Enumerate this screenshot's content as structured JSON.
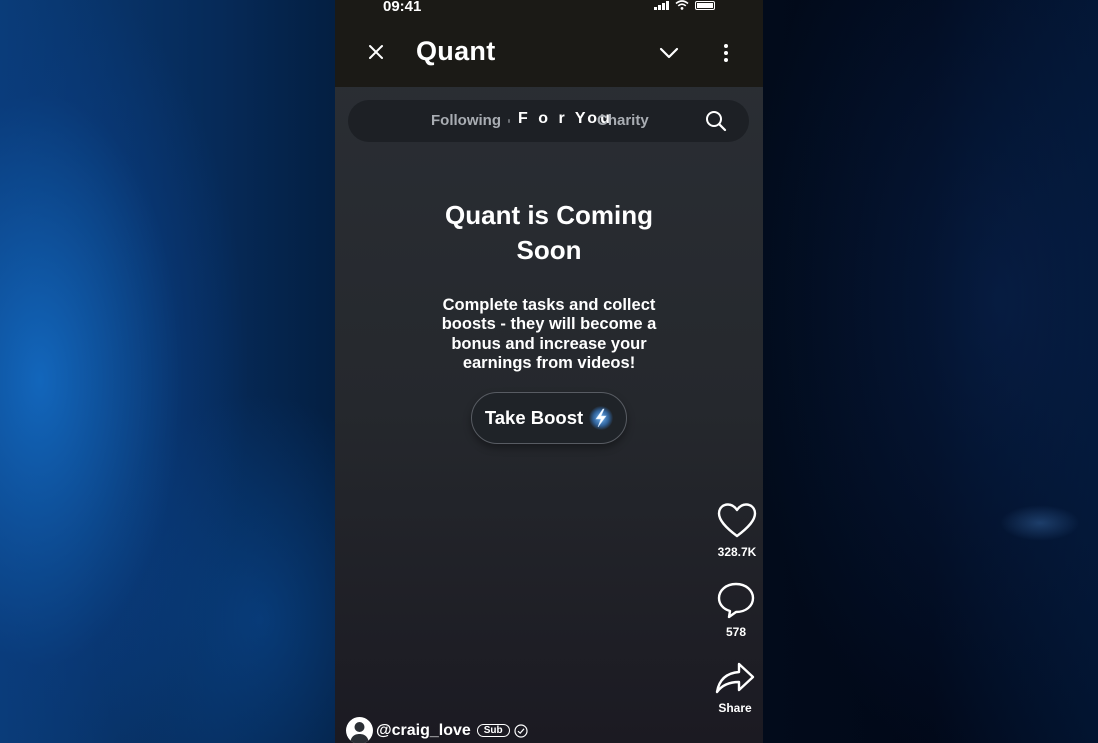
{
  "status_bar": {
    "time": "09:41",
    "icons": [
      "cellular-signal-icon",
      "wifi-icon",
      "battery-icon"
    ]
  },
  "header": {
    "title": "Quant",
    "icons": [
      "close-icon",
      "chevron-down-icon",
      "more-vertical-icon"
    ]
  },
  "tabs": [
    {
      "label": "Following",
      "active": false
    },
    {
      "label": "F o r You",
      "active": true
    },
    {
      "label": "Charity",
      "active": false
    }
  ],
  "hero": {
    "title": "Quant is Coming Soon",
    "description": "Complete tasks and collect boosts - they will become a bonus and increase your earnings from videos!",
    "button_label": "Take Boost",
    "button_icon": "lightning-bolt-icon"
  },
  "actions": {
    "likes": {
      "icon": "heart-icon",
      "count": "328.7K"
    },
    "comments": {
      "icon": "comment-bubble-icon",
      "count": "578"
    },
    "share": {
      "icon": "share-arrow-icon",
      "label": "Share"
    }
  },
  "footer": {
    "username": "@craig_love",
    "badge": "Sub",
    "verified_icon": "verified-check-icon"
  },
  "colors": {
    "header_bg": "#1b1a16",
    "screen_bg": "#2b2f35",
    "accent_bolt": "#5aaaf0"
  }
}
